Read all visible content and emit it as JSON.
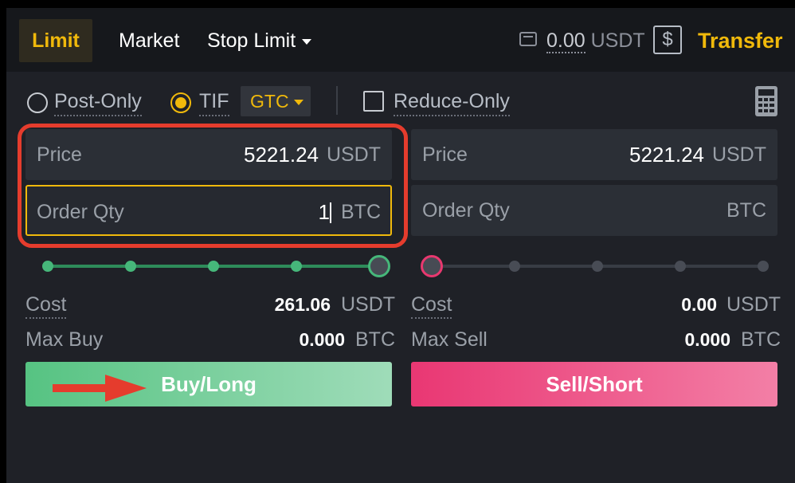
{
  "tabs": {
    "limit": "Limit",
    "market": "Market",
    "stop_limit": "Stop Limit"
  },
  "header": {
    "balance_value": "0.00",
    "balance_unit": "USDT",
    "dollar_glyph": "$",
    "transfer": "Transfer"
  },
  "options": {
    "post_only": "Post-Only",
    "tif": "TIF",
    "tif_value": "GTC",
    "reduce_only": "Reduce-Only",
    "post_only_checked": false,
    "tif_checked": true,
    "reduce_only_checked": false
  },
  "buy": {
    "price_label": "Price",
    "price_value": "5221.24",
    "price_unit": "USDT",
    "qty_label": "Order Qty",
    "qty_value": "1",
    "qty_unit": "BTC",
    "slider_percent": 100,
    "cost_label": "Cost",
    "cost_value": "261.06",
    "cost_unit": "USDT",
    "max_label": "Max Buy",
    "max_value": "0.000",
    "max_unit": "BTC",
    "button": "Buy/Long"
  },
  "sell": {
    "price_label": "Price",
    "price_value": "5221.24",
    "price_unit": "USDT",
    "qty_label": "Order Qty",
    "qty_value": "",
    "qty_unit": "BTC",
    "slider_percent": 0,
    "cost_label": "Cost",
    "cost_value": "0.00",
    "cost_unit": "USDT",
    "max_label": "Max Sell",
    "max_value": "0.000",
    "max_unit": "BTC",
    "button": "Sell/Short"
  },
  "colors": {
    "accent": "#f0b90b",
    "buy": "#56c382",
    "sell": "#e93773",
    "annotation": "#e53c2d"
  },
  "icons": [
    "wallet-icon",
    "dollar-icon",
    "calculator-icon",
    "chevron-down-icon",
    "arrow-annotation-icon"
  ]
}
